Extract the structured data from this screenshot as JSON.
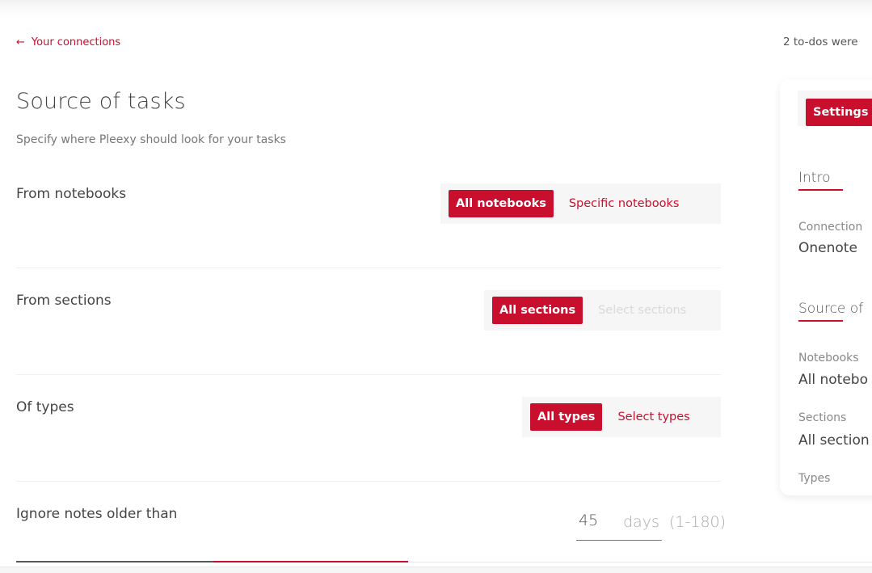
{
  "nav": {
    "back_label": "Your connections",
    "back_icon": "arrow-left-icon"
  },
  "notice": "2 to-dos were",
  "page": {
    "title": "Source of tasks",
    "subtitle": "Specify where Pleexy should look for your tasks"
  },
  "rows": {
    "notebooks": {
      "label": "From notebooks",
      "options": [
        "All notebooks",
        "Specific notebooks"
      ],
      "selected": "All notebooks"
    },
    "sections": {
      "label": "From sections",
      "options": [
        "All sections",
        "Select sections"
      ],
      "selected": "All sections"
    },
    "types": {
      "label": "Of types",
      "options": [
        "All types",
        "Select types"
      ],
      "selected": "All types"
    },
    "ignore": {
      "label": "Ignore notes older than",
      "value": "45",
      "unit": "days",
      "range": "(1-180)"
    }
  },
  "sidebar": {
    "tab_label": "Settings",
    "intro_heading": "Intro",
    "connection_key": "Connection",
    "connection_value": "Onenote",
    "source_heading": "Source of",
    "notebooks_key": "Notebooks",
    "notebooks_value": "All notebo",
    "sections_key": "Sections",
    "sections_value": "All section",
    "types_key": "Types"
  },
  "colors": {
    "accent": "#c8102e",
    "text": "#444444",
    "muted": "#777777",
    "segment_bg": "#f6f6f6"
  }
}
